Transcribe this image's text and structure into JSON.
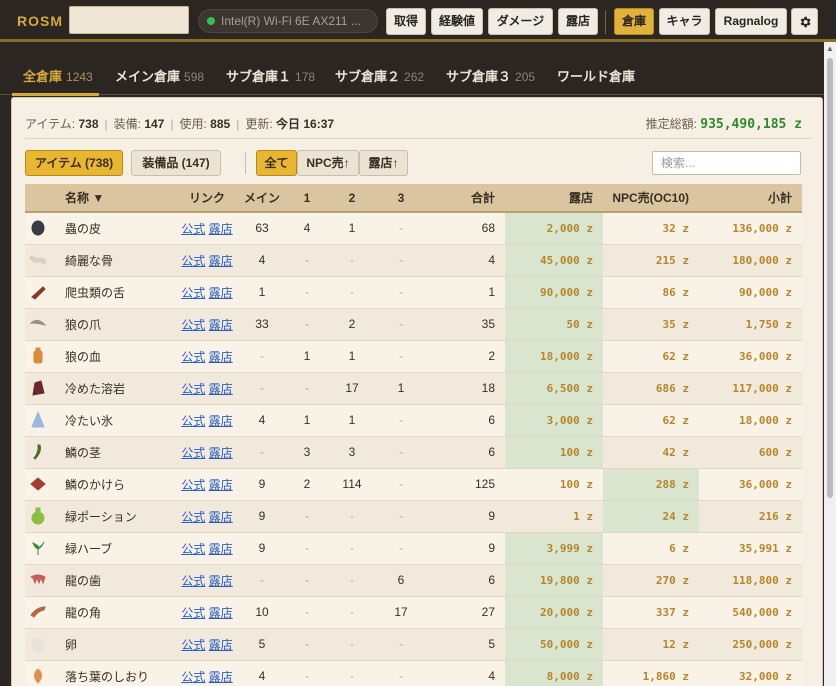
{
  "app": {
    "brand": "ROSM",
    "name_value": ""
  },
  "network": {
    "label": "Intel(R) Wi-Fi 6E AX211 ..."
  },
  "toolbar": [
    {
      "label": "取得",
      "active": false
    },
    {
      "label": "経験値",
      "active": false
    },
    {
      "label": "ダメージ",
      "active": false
    },
    {
      "label": "露店",
      "active": false
    },
    {
      "label": "倉庫",
      "active": true
    },
    {
      "label": "キャラ",
      "active": false
    },
    {
      "label": "Ragnalog",
      "active": false
    },
    {
      "label": "",
      "icon": "gear-icon",
      "active": false
    }
  ],
  "tabs": [
    {
      "label": "全倉庫",
      "count": "1243",
      "active": true
    },
    {
      "label": "メイン倉庫",
      "count": "598"
    },
    {
      "label": "サブ倉庫１",
      "count": "178"
    },
    {
      "label": "サブ倉庫２",
      "count": "262"
    },
    {
      "label": "サブ倉庫３",
      "count": "205"
    },
    {
      "label": "ワールド倉庫",
      "count": ""
    }
  ],
  "stats": {
    "items_label": "アイテム:",
    "items": "738",
    "equip_label": "装備:",
    "equip": "147",
    "use_label": "使用:",
    "use": "885",
    "updated_label": "更新:",
    "updated": "今日 16:37",
    "total_label": "推定総額:",
    "total": "935,490,185 z"
  },
  "filters": {
    "item_btn": "アイテム (738)",
    "equip_btn": "装備品 (147)",
    "all_btn": "全て",
    "npc_btn": "NPC売↑",
    "shop_btn": "露店↑",
    "search_placeholder": "検索..."
  },
  "table": {
    "headers": {
      "name": "名称 ▼",
      "link": "リンク",
      "main": "メイン",
      "s1": "1",
      "s2": "2",
      "s3": "3",
      "total": "合計",
      "shop": "露店",
      "npc": "NPC売(OC10)",
      "sub": "小計"
    },
    "link_official": "公式",
    "link_shop": "露店",
    "rows": [
      {
        "icon": "insect-skin-icon",
        "color": "#3a3a44",
        "name": "蟲の皮",
        "main": "63",
        "s1": "4",
        "s2": "1",
        "s3": "-",
        "total": "68",
        "shop": "2,000 z",
        "npc": "32 z",
        "sub": "136,000 z",
        "hl": "shop"
      },
      {
        "icon": "bone-icon",
        "color": "#d8d2c4",
        "name": "綺麗な骨",
        "main": "4",
        "s1": "-",
        "s2": "-",
        "s3": "-",
        "total": "4",
        "shop": "45,000 z",
        "npc": "215 z",
        "sub": "180,000 z",
        "hl": "shop"
      },
      {
        "icon": "reptile-tongue-icon",
        "color": "#8a3a2a",
        "name": "爬虫類の舌",
        "main": "1",
        "s1": "-",
        "s2": "-",
        "s3": "-",
        "total": "1",
        "shop": "90,000 z",
        "npc": "86 z",
        "sub": "90,000 z",
        "hl": "shop"
      },
      {
        "icon": "wolf-claw-icon",
        "color": "#9a8f80",
        "name": "狼の爪",
        "main": "33",
        "s1": "-",
        "s2": "2",
        "s3": "-",
        "total": "35",
        "shop": "50 z",
        "npc": "35 z",
        "sub": "1,750 z",
        "hl": "shop"
      },
      {
        "icon": "wolf-blood-icon",
        "color": "#d98a3a",
        "name": "狼の血",
        "main": "-",
        "s1": "1",
        "s2": "1",
        "s3": "-",
        "total": "2",
        "shop": "18,000 z",
        "npc": "62 z",
        "sub": "36,000 z",
        "hl": "shop"
      },
      {
        "icon": "cold-lava-icon",
        "color": "#6a2a2a",
        "name": "冷めた溶岩",
        "main": "-",
        "s1": "-",
        "s2": "17",
        "s3": "1",
        "total": "18",
        "shop": "6,500 z",
        "npc": "686 z",
        "sub": "117,000 z",
        "hl": "shop"
      },
      {
        "icon": "cold-ice-icon",
        "color": "#9ab8e0",
        "name": "冷たい氷",
        "main": "4",
        "s1": "1",
        "s2": "1",
        "s3": "-",
        "total": "6",
        "shop": "3,000 z",
        "npc": "62 z",
        "sub": "18,000 z",
        "hl": "shop"
      },
      {
        "icon": "scale-stem-icon",
        "color": "#4a6a2a",
        "name": "鱗の茎",
        "main": "-",
        "s1": "3",
        "s2": "3",
        "s3": "-",
        "total": "6",
        "shop": "100 z",
        "npc": "42 z",
        "sub": "600 z",
        "hl": "shop"
      },
      {
        "icon": "scale-shard-icon",
        "color": "#a04030",
        "name": "鱗のかけら",
        "main": "9",
        "s1": "2",
        "s2": "114",
        "s3": "-",
        "total": "125",
        "shop": "100 z",
        "npc": "288 z",
        "sub": "36,000 z",
        "hl": "npc"
      },
      {
        "icon": "green-potion-icon",
        "color": "#8ac040",
        "name": "緑ポーション",
        "main": "9",
        "s1": "-",
        "s2": "-",
        "s3": "-",
        "total": "9",
        "shop": "1 z",
        "npc": "24 z",
        "sub": "216 z",
        "hl": "npc"
      },
      {
        "icon": "green-herb-icon",
        "color": "#3a8a3a",
        "name": "緑ハーブ",
        "main": "9",
        "s1": "-",
        "s2": "-",
        "s3": "-",
        "total": "9",
        "shop": "3,999 z",
        "npc": "6 z",
        "sub": "35,991 z",
        "hl": "shop"
      },
      {
        "icon": "dragon-fang-icon",
        "color": "#c0605a",
        "name": "龍の歯",
        "main": "-",
        "s1": "-",
        "s2": "-",
        "s3": "6",
        "total": "6",
        "shop": "19,800 z",
        "npc": "270 z",
        "sub": "118,800 z",
        "hl": "shop"
      },
      {
        "icon": "dragon-horn-icon",
        "color": "#b06a40",
        "name": "龍の角",
        "main": "10",
        "s1": "-",
        "s2": "-",
        "s3": "17",
        "total": "27",
        "shop": "20,000 z",
        "npc": "337 z",
        "sub": "540,000 z",
        "hl": "shop"
      },
      {
        "icon": "egg-icon",
        "color": "#e8e2d8",
        "name": "卵",
        "main": "5",
        "s1": "-",
        "s2": "-",
        "s3": "-",
        "total": "5",
        "shop": "50,000 z",
        "npc": "12 z",
        "sub": "250,000 z",
        "hl": "shop"
      },
      {
        "icon": "fallen-leaf-bookmark-icon",
        "color": "#e0904a",
        "name": "落ち葉のしおり",
        "main": "4",
        "s1": "-",
        "s2": "-",
        "s3": "-",
        "total": "4",
        "shop": "8,000 z",
        "npc": "1,860 z",
        "sub": "32,000 z",
        "hl": "shop"
      }
    ]
  }
}
